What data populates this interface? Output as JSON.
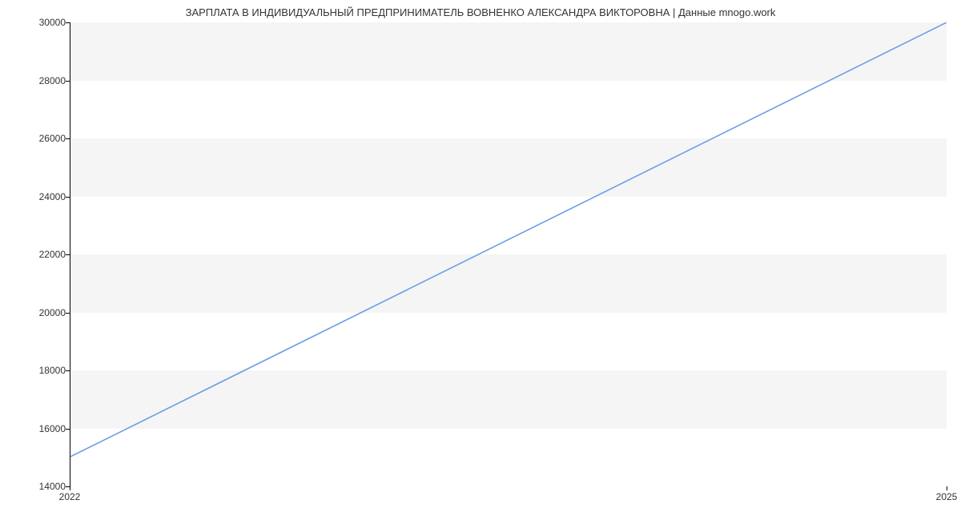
{
  "chart_data": {
    "type": "line",
    "title": "ЗАРПЛАТА В ИНДИВИДУАЛЬНЫЙ ПРЕДПРИНИМАТЕЛЬ ВОВНЕНКО АЛЕКСАНДРА ВИКТОРОВНА | Данные mnogo.work",
    "x": [
      2022,
      2025
    ],
    "values": [
      15000,
      30000
    ],
    "xlabel": "",
    "ylabel": "",
    "xlim": [
      2022,
      2025
    ],
    "ylim": [
      14000,
      30000
    ],
    "y_ticks": [
      14000,
      16000,
      18000,
      20000,
      22000,
      24000,
      26000,
      28000,
      30000
    ],
    "x_ticks": [
      2022,
      2025
    ],
    "grid": true,
    "line_color": "#6a9ee8"
  }
}
